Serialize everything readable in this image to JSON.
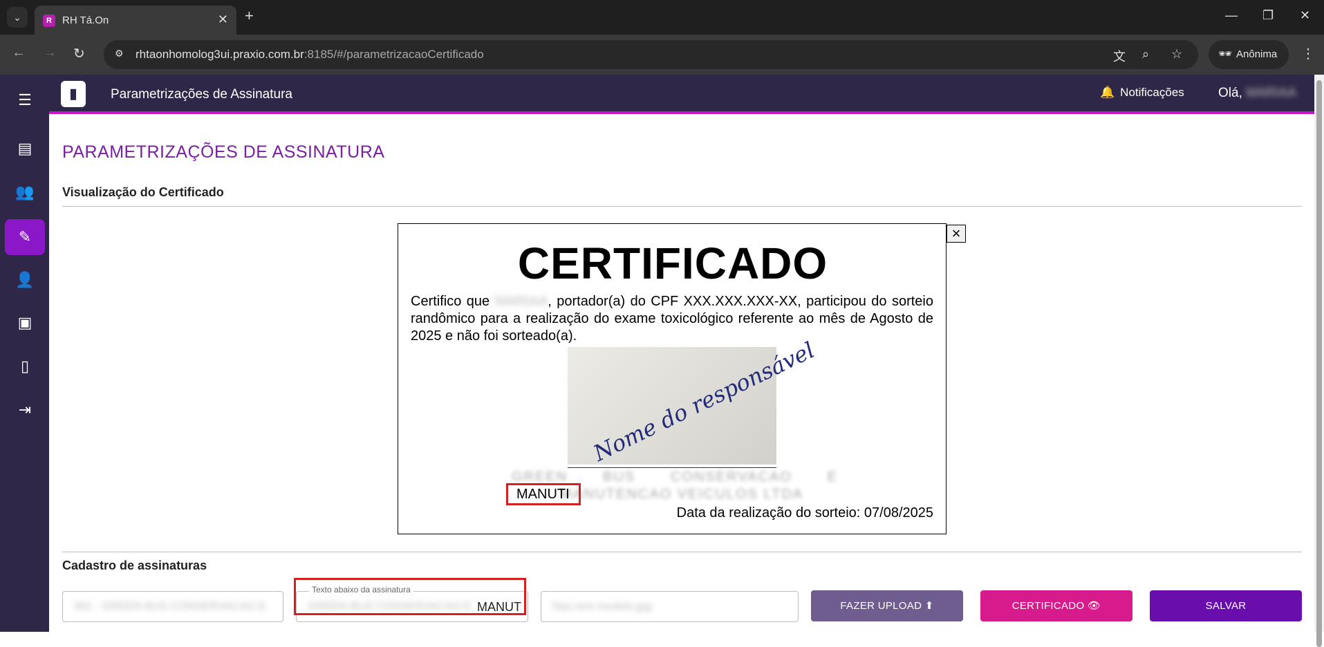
{
  "browser": {
    "tab_title": "RH Tá.On",
    "url_host": "rhtaonhomolog3ui.praxio.com.br",
    "url_path": ":8185/#/parametrizacaoCertificado",
    "profile_label": "Anônima"
  },
  "header": {
    "title": "Parametrizações de Assinatura",
    "notifications_label": "Notificações",
    "greeting": "Olá,",
    "user_name": "MARIAA"
  },
  "page": {
    "title": "PARAMETRIZAÇÕES DE ASSINATURA",
    "preview_section": "Visualização do Certificado",
    "register_section": "Cadastro de assinaturas"
  },
  "certificate": {
    "heading": "CERTIFICADO",
    "body_start": "Certifico que ",
    "person_name": "MARIAA",
    "body_rest": ", portador(a) do CPF XXX.XXX.XXX-XX, participou do sorteio randômico para a realização do exame toxicológico referente ao mês de Agosto de 2025 e não foi sorteado(a).",
    "signature_text": "Nome do responsável",
    "company_line1": "GREEN BUS CONSERVACAO E",
    "company_line2": "MANUTENCAO VEICULOS LTDA",
    "highlight_text": "MANUTI",
    "date_label": "Data da realização do sorteio: 07/08/2025",
    "close_symbol": "×"
  },
  "form": {
    "company_field": "901 - GREEN BUS CONSERVACAO E",
    "text_field_label": "Texto abaixo da assinatura",
    "text_field_blurred": "GREEN BUS CONSERVACAO E",
    "text_field_visible": "MANUT",
    "file_placeholder": "Nao tem modelo.jpg",
    "upload_label": "FAZER UPLOAD",
    "certificate_label": "CERTIFICADO",
    "save_label": "SALVAR"
  },
  "colors": {
    "sidebar": "#2f2747",
    "accent_active": "#8a18c8",
    "header_underline": "#c516c7",
    "title_purple": "#7a1fa2",
    "upload_button": "#6e5d8e",
    "certificate_button": "#d81b8c",
    "save_button": "#6a0dad",
    "highlight_red": "#d32020"
  },
  "icons": {
    "sidebar": [
      "menu-icon",
      "chat-icon",
      "users-icon",
      "edit-icon",
      "user-add-icon",
      "badge-icon",
      "document-icon",
      "logout-icon"
    ]
  }
}
